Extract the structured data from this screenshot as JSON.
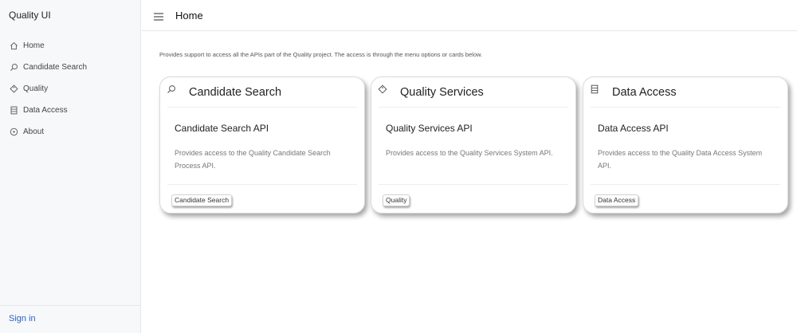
{
  "app": {
    "title": "Quality UI"
  },
  "sidebar": {
    "items": [
      {
        "label": "Home",
        "icon": "home-icon"
      },
      {
        "label": "Candidate Search",
        "icon": "search-icon"
      },
      {
        "label": "Quality",
        "icon": "tag-icon"
      },
      {
        "label": "Data Access",
        "icon": "database-icon"
      },
      {
        "label": "About",
        "icon": "info-circle-icon"
      }
    ],
    "signin_label": "Sign in"
  },
  "header": {
    "title": "Home",
    "menu_icon": "hamburger-icon"
  },
  "main": {
    "intro": "Provides support to access all the APIs part of the Quality project. The access is through the menu options or cards below.",
    "cards": [
      {
        "header": "Candidate Search",
        "icon": "search-icon",
        "title": "Candidate Search API",
        "description": "Provides access to the Quality Candidate Search Process API.",
        "tag": "Candidate Search"
      },
      {
        "header": "Quality Services",
        "icon": "tag-icon",
        "title": "Quality Services API",
        "description": "Provides access to the Quality Services System API.",
        "tag": "Quality"
      },
      {
        "header": "Data Access",
        "icon": "database-icon",
        "title": "Data Access API",
        "description": "Provides access to the Quality Data Access System API.",
        "tag": "Data Access"
      }
    ]
  },
  "colors": {
    "accent_link": "#2a62c9",
    "sidebar_bg": "#f7f8f9",
    "text_muted": "#777777"
  }
}
